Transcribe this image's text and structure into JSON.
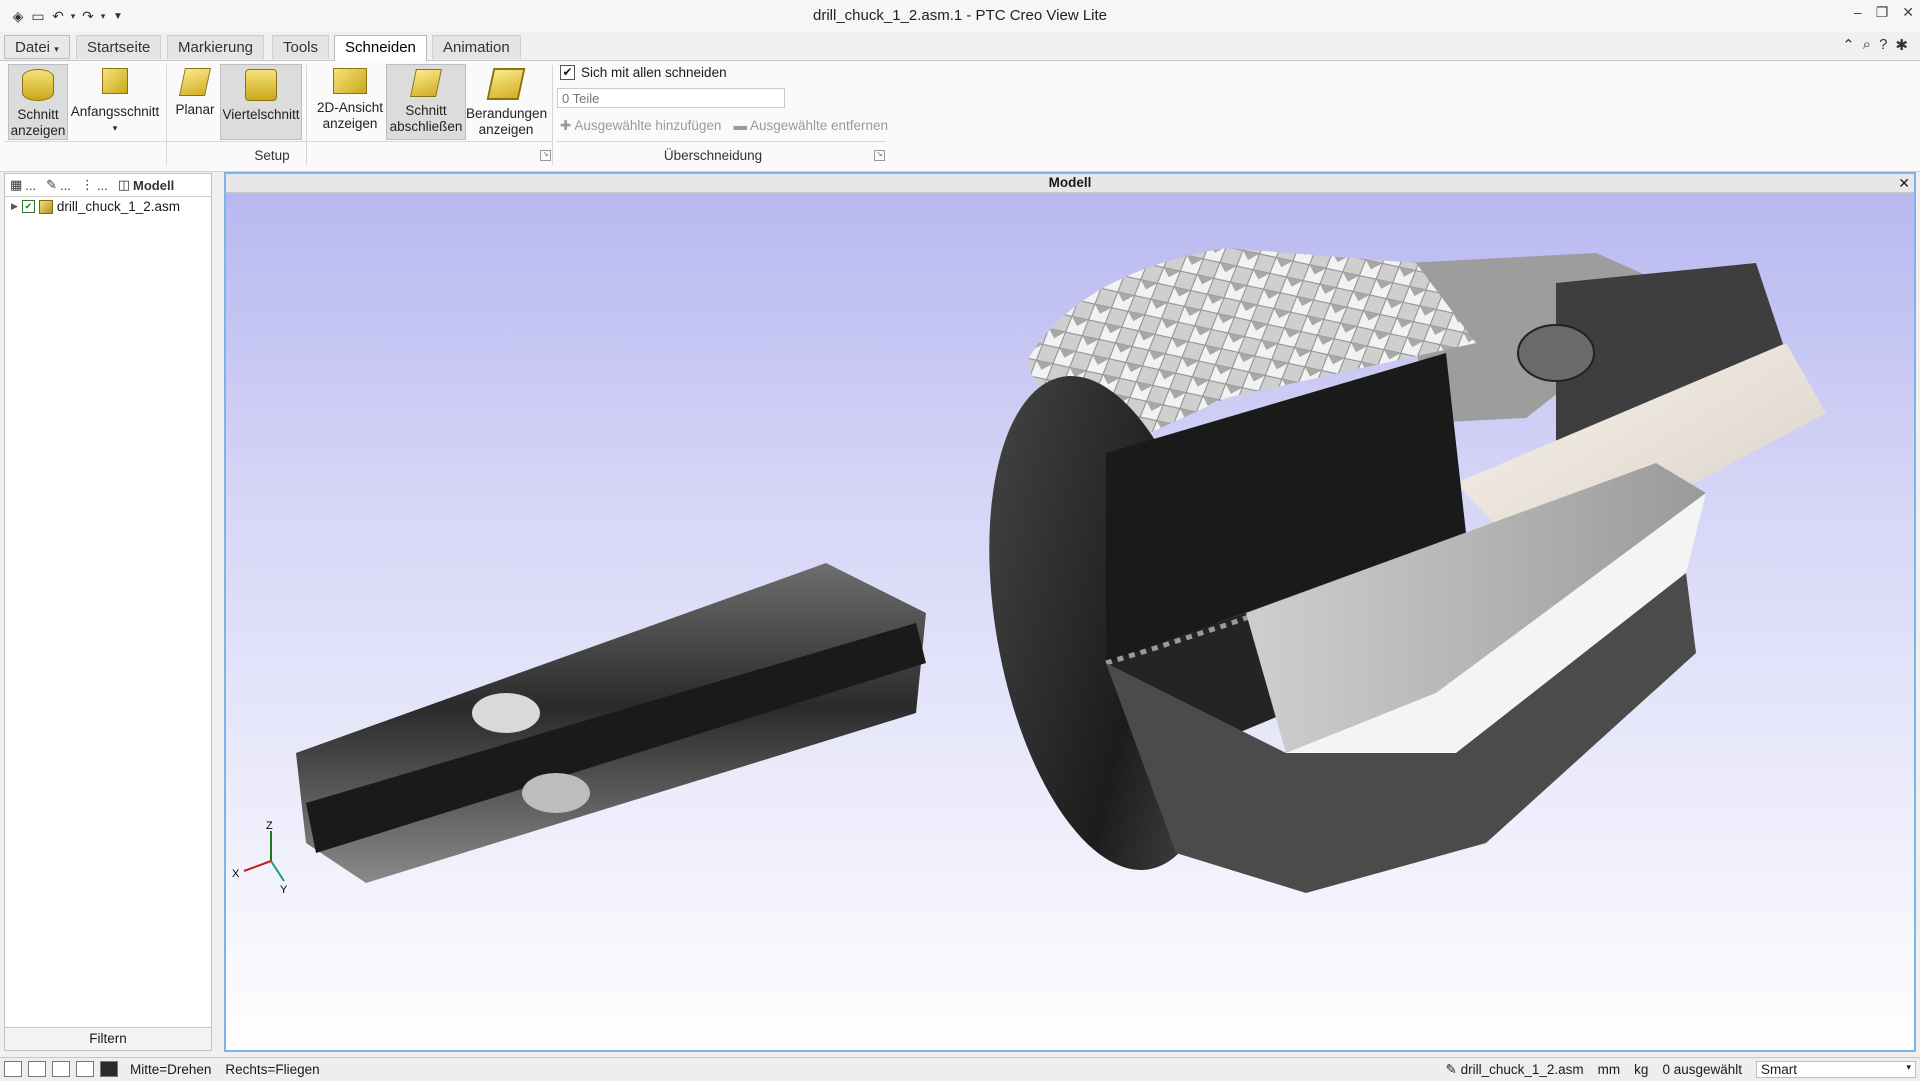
{
  "window": {
    "title": "drill_chuck_1_2.asm.1 - PTC Creo View Lite"
  },
  "ribbon_tabs": [
    {
      "label": "Datei"
    },
    {
      "label": "Startseite"
    },
    {
      "label": "Markierung"
    },
    {
      "label": "Tools"
    },
    {
      "label": "Schneiden"
    },
    {
      "label": "Animation"
    }
  ],
  "setup": {
    "group_label": "Setup",
    "buttons": [
      {
        "line1": "Schnitt",
        "line2": "anzeigen"
      },
      {
        "line1": "Anfangsschnitt",
        "line2": ""
      },
      {
        "line1": "Planar",
        "line2": ""
      },
      {
        "line1": "Viertelschnitt",
        "line2": ""
      },
      {
        "line1": "2D-Ansicht",
        "line2": "anzeigen"
      },
      {
        "line1": "Schnitt",
        "line2": "abschließen"
      },
      {
        "line1": "Berandungen",
        "line2": "anzeigen"
      }
    ]
  },
  "intersection": {
    "group_label": "Überschneidung",
    "checkbox_label": "Sich mit allen schneiden",
    "parts_placeholder": "0 Teile",
    "add_label": "Ausgewählte hinzufügen",
    "remove_label": "Ausgewählte entfernen"
  },
  "left_panel": {
    "tabs": [
      {
        "label": "..."
      },
      {
        "label": "..."
      },
      {
        "label": "..."
      },
      {
        "label": "Modell"
      }
    ],
    "tree_item": "drill_chuck_1_2.asm",
    "filter_label": "Filtern"
  },
  "viewport": {
    "title": "Modell",
    "axes": {
      "z": "Z",
      "x": "X",
      "y": "Y"
    }
  },
  "status": {
    "mouse_hint_1": "Mitte=Drehen",
    "mouse_hint_2": "Rechts=Fliegen",
    "model": "drill_chuck_1_2.asm",
    "length_unit": "mm",
    "mass_unit": "kg",
    "selected": "0 ausgewählt",
    "filter_mode": "Smart"
  }
}
